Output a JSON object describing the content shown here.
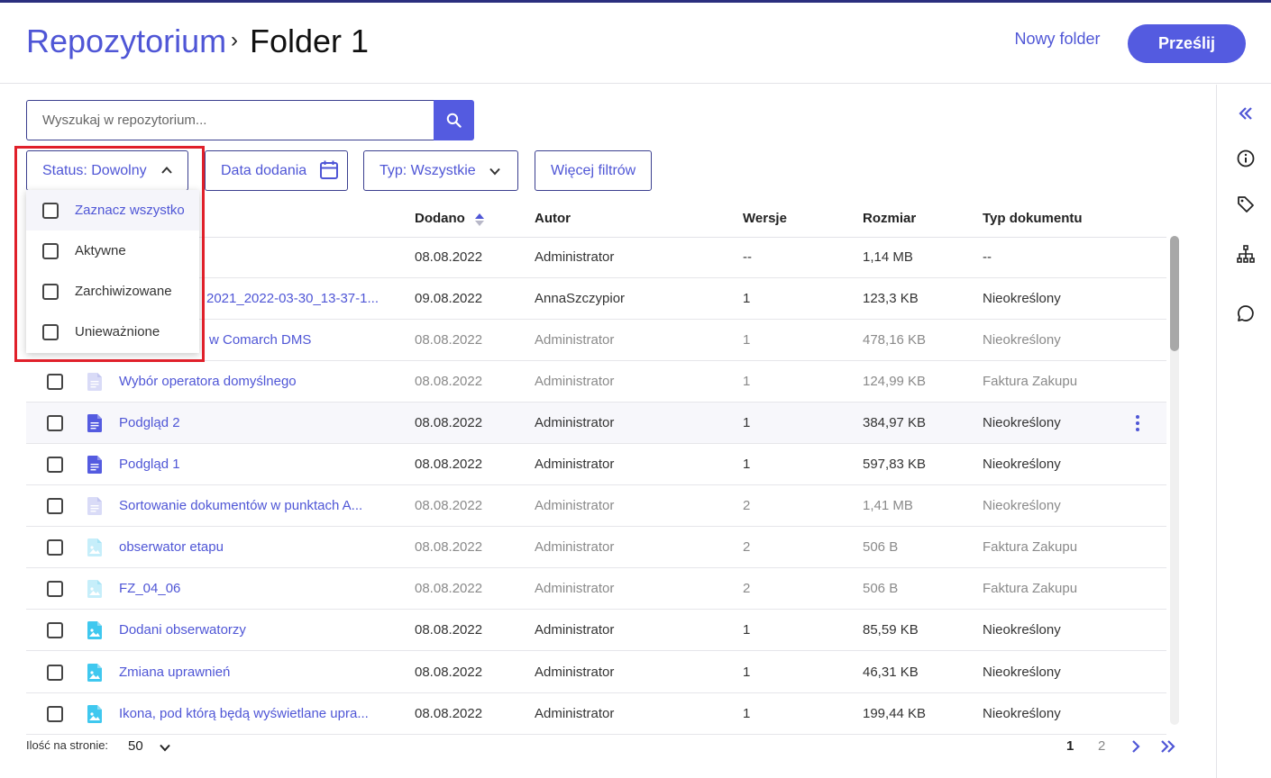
{
  "header": {
    "breadcrumb_root": "Repozytorium",
    "breadcrumb_sep": "›",
    "breadcrumb_current": "Folder 1",
    "new_folder": "Nowy folder",
    "upload": "Prześlij"
  },
  "search": {
    "placeholder": "Wyszukaj w repozytorium..."
  },
  "filters": {
    "status": "Status: Dowolny",
    "date": "Data dodania",
    "type": "Typ: Wszystkie",
    "more": "Więcej filtrów"
  },
  "status_dropdown": {
    "items": [
      "Zaznacz wszystko",
      "Aktywne",
      "Zarchiwizowane",
      "Unieważnione"
    ]
  },
  "table": {
    "columns": [
      "Dodano",
      "Autor",
      "Wersje",
      "Rozmiar",
      "Typ dokumentu"
    ],
    "rows": [
      {
        "name": "",
        "added": "08.08.2022",
        "author": "Administrator",
        "versions": "--",
        "size": "1,14 MB",
        "type": "--"
      },
      {
        "name": "2021_2022-03-30_13-37-1...",
        "added": "09.08.2022",
        "author": "AnnaSzczypior",
        "versions": "1",
        "size": "123,3 KB",
        "type": "Nieokreślony"
      },
      {
        "name": "w Comarch DMS",
        "added": "08.08.2022",
        "author": "Administrator",
        "versions": "1",
        "size": "478,16 KB",
        "type": "Nieokreślony"
      },
      {
        "name": "Wybór operatora domyślnego",
        "added": "08.08.2022",
        "author": "Administrator",
        "versions": "1",
        "size": "124,99 KB",
        "type": "Faktura Zakupu"
      },
      {
        "name": "Podgląd 2",
        "added": "08.08.2022",
        "author": "Administrator",
        "versions": "1",
        "size": "384,97 KB",
        "type": "Nieokreślony"
      },
      {
        "name": "Podgląd 1",
        "added": "08.08.2022",
        "author": "Administrator",
        "versions": "1",
        "size": "597,83 KB",
        "type": "Nieokreślony"
      },
      {
        "name": "Sortowanie dokumentów w punktach A...",
        "added": "08.08.2022",
        "author": "Administrator",
        "versions": "2",
        "size": "1,41 MB",
        "type": "Nieokreślony"
      },
      {
        "name": "obserwator etapu",
        "added": "08.08.2022",
        "author": "Administrator",
        "versions": "2",
        "size": "506 B",
        "type": "Faktura Zakupu"
      },
      {
        "name": "FZ_04_06",
        "added": "08.08.2022",
        "author": "Administrator",
        "versions": "2",
        "size": "506 B",
        "type": "Faktura Zakupu"
      },
      {
        "name": "Dodani obserwatorzy",
        "added": "08.08.2022",
        "author": "Administrator",
        "versions": "1",
        "size": "85,59 KB",
        "type": "Nieokreślony"
      },
      {
        "name": "Zmiana uprawnień",
        "added": "08.08.2022",
        "author": "Administrator",
        "versions": "1",
        "size": "46,31 KB",
        "type": "Nieokreślony"
      },
      {
        "name": "Ikona, pod którą będą wyświetlane upra...",
        "added": "08.08.2022",
        "author": "Administrator",
        "versions": "1",
        "size": "199,44 KB",
        "type": "Nieokreślony"
      }
    ]
  },
  "footer": {
    "per_page_label": "Ilość na stronie:",
    "per_page_value": "50",
    "pages": [
      "1",
      "2"
    ]
  }
}
